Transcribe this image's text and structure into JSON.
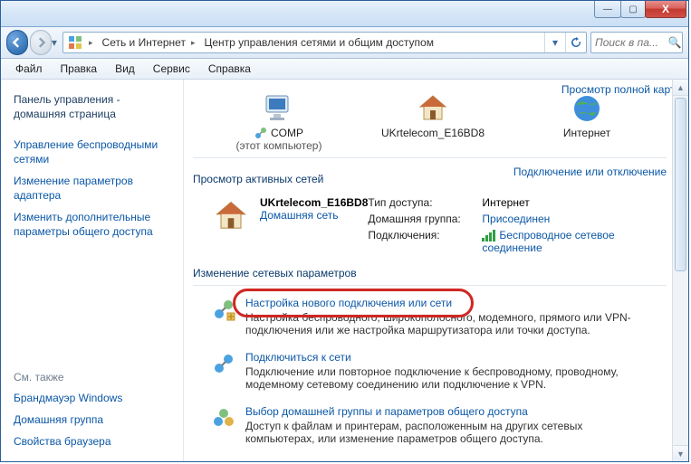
{
  "window": {
    "close": "X",
    "min": "—",
    "max": "▢"
  },
  "breadcrumb": {
    "seg1": "Сеть и Интернет",
    "seg2": "Центр управления сетями и общим доступом"
  },
  "search": {
    "placeholder": "Поиск в па..."
  },
  "menu": {
    "file": "Файл",
    "edit": "Правка",
    "view": "Вид",
    "tools": "Сервис",
    "help": "Справка"
  },
  "sidebar": {
    "home1": "Панель управления -",
    "home2": "домашняя страница",
    "items": [
      "Управление беспроводными сетями",
      "Изменение параметров адаптера",
      "Изменить дополнительные параметры общего доступа"
    ],
    "seeAlso": "См. также",
    "bottom": [
      "Брандмауэр Windows",
      "Домашняя группа",
      "Свойства браузера"
    ]
  },
  "map": {
    "viewFull": "Просмотр полной карты",
    "comp": "COMP",
    "compSub": "(этот компьютер)",
    "router": "UKrtelecom_E16BD8",
    "internet": "Интернет"
  },
  "active": {
    "title": "Просмотр активных сетей",
    "toggle": "Подключение или отключение",
    "name": "UKrtelecom_E16BD8",
    "type": "Домашняя сеть",
    "kAccess": "Тип доступа:",
    "vAccess": "Интернет",
    "kHome": "Домашняя группа:",
    "vHome": "Присоединен",
    "kConn": "Подключения:",
    "vConn": "Беспроводное сетевое соединение"
  },
  "change": {
    "title": "Изменение сетевых параметров",
    "opt1": {
      "title": "Настройка нового подключения или сети",
      "desc": "Настройка беспроводного, широкополосного, модемного, прямого или VPN-подключения или же настройка маршрутизатора или точки доступа."
    },
    "opt2": {
      "title": "Подключиться к сети",
      "desc": "Подключение или повторное подключение к беспроводному, проводному, модемному сетевому соединению или подключение к VPN."
    },
    "opt3": {
      "title": "Выбор домашней группы и параметров общего доступа",
      "desc": "Доступ к файлам и принтерам, расположенным на других сетевых компьютерах, или изменение параметров общего доступа."
    }
  }
}
